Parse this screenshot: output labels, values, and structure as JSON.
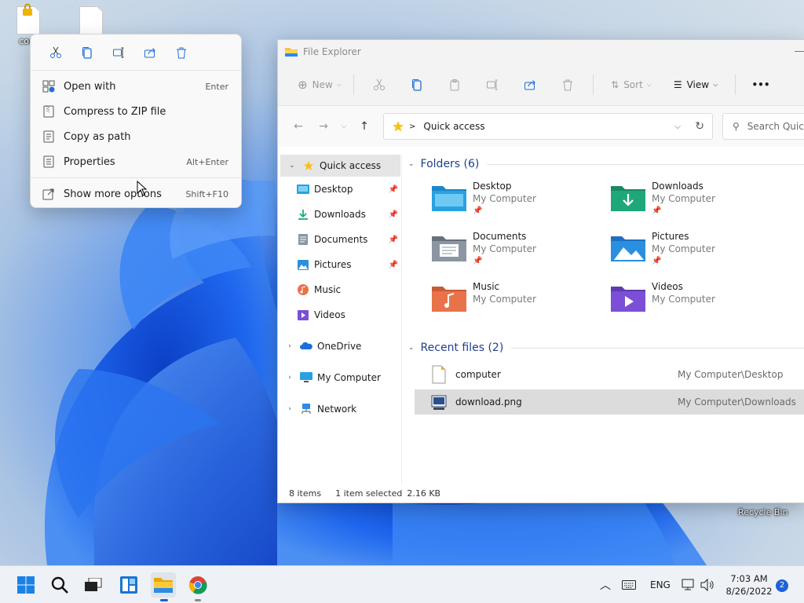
{
  "desktop": {
    "icons": [
      {
        "label": "com"
      },
      {
        "label": ""
      }
    ],
    "recycle_bin": "Recycle Bin"
  },
  "context_menu": {
    "quick_actions": [
      "cut-icon",
      "copy-icon",
      "rename-icon",
      "share-icon",
      "delete-icon"
    ],
    "items": [
      {
        "label": "Open with",
        "shortcut": "Enter",
        "icon": "open-with-icon"
      },
      {
        "label": "Compress to ZIP file",
        "shortcut": "",
        "icon": "zip-icon"
      },
      {
        "label": "Copy as path",
        "shortcut": "",
        "icon": "copy-path-icon"
      },
      {
        "label": "Properties",
        "shortcut": "Alt+Enter",
        "icon": "properties-icon"
      },
      {
        "label": "Show more options",
        "shortcut": "Shift+F10",
        "icon": "more-options-icon"
      }
    ]
  },
  "explorer": {
    "title": "File Explorer",
    "toolbar": {
      "new_label": "New",
      "sort_label": "Sort",
      "view_label": "View",
      "more_label": "•••"
    },
    "address": {
      "location": "Quick access",
      "search_placeholder": "Search Quick access"
    },
    "nav": {
      "quick_access": "Quick access",
      "pinned": [
        {
          "label": "Desktop",
          "pinned": true
        },
        {
          "label": "Downloads",
          "pinned": true
        },
        {
          "label": "Documents",
          "pinned": true
        },
        {
          "label": "Pictures",
          "pinned": true
        },
        {
          "label": "Music",
          "pinned": false
        },
        {
          "label": "Videos",
          "pinned": false
        }
      ],
      "roots": [
        "OneDrive",
        "My Computer",
        "Network"
      ]
    },
    "folders": {
      "header": "Folders (6)",
      "items": [
        {
          "name": "Desktop",
          "location": "My Computer",
          "pinned": true,
          "color": "#2aa0e0"
        },
        {
          "name": "Downloads",
          "location": "My Computer",
          "pinned": true,
          "color": "#1fa77a"
        },
        {
          "name": "Documents",
          "location": "My Computer",
          "pinned": true,
          "color": "#7b8794"
        },
        {
          "name": "Pictures",
          "location": "My Computer",
          "pinned": true,
          "color": "#2b8fe0"
        },
        {
          "name": "Music",
          "location": "My Computer",
          "pinned": false,
          "color": "#e8734a"
        },
        {
          "name": "Videos",
          "location": "My Computer",
          "pinned": false,
          "color": "#7b4fd6"
        }
      ]
    },
    "recent": {
      "header": "Recent files (2)",
      "items": [
        {
          "name": "computer",
          "location": "My Computer\\Desktop",
          "selected": false
        },
        {
          "name": "download.png",
          "location": "My Computer\\Downloads",
          "selected": true
        }
      ]
    },
    "status": {
      "count": "8 items",
      "selection": "1 item selected",
      "size": "2.16 KB"
    }
  },
  "taskbar": {
    "language": "ENG",
    "time": "7:03 AM",
    "date": "8/26/2022",
    "notifications": "2"
  },
  "colors": {
    "accent": "#1a63d9",
    "folder_header": "#1f3f8f",
    "selection": "#dcdcdc"
  }
}
